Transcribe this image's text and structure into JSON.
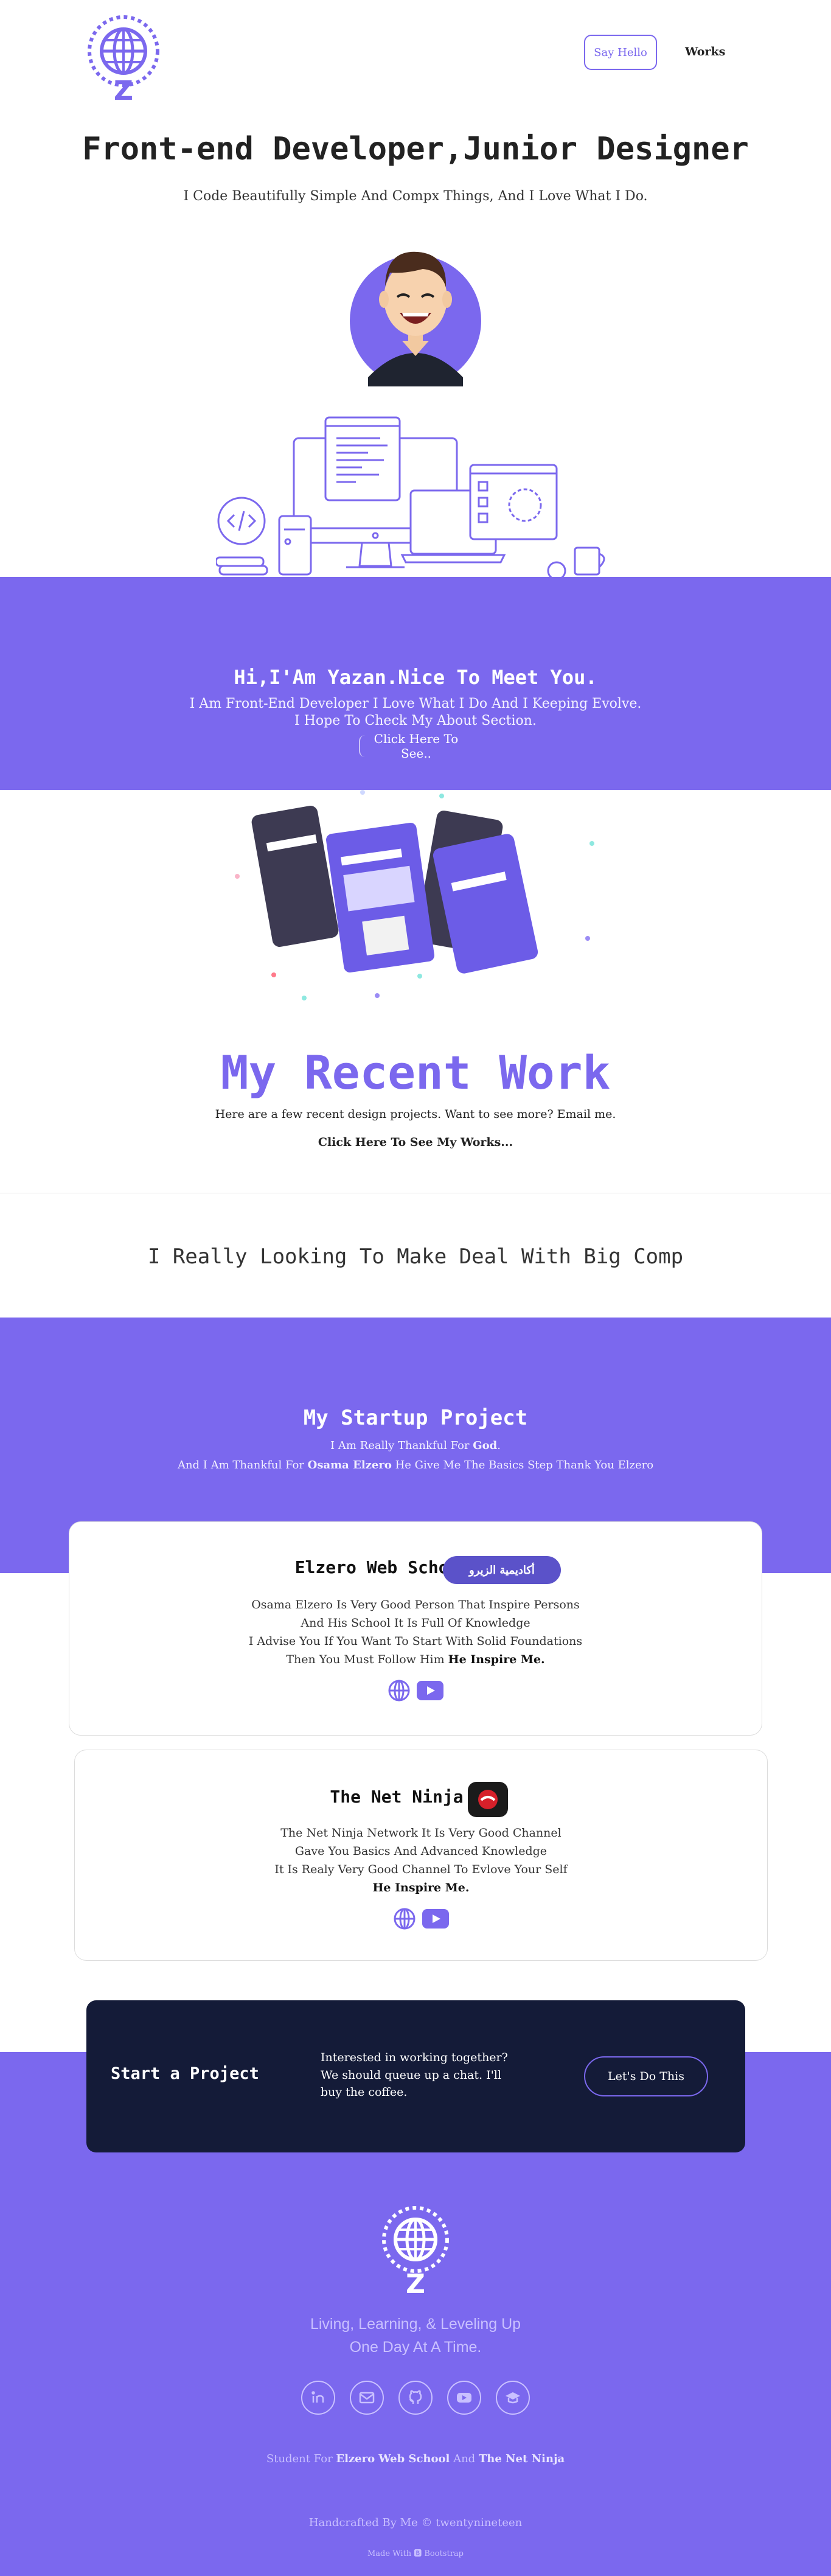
{
  "nav": {
    "say_hello": "Say Hello",
    "works": "Works",
    "logo_letter": "Z"
  },
  "hero": {
    "title": "Front-end Developer,Junior Designer",
    "subtitle": "I Code Beautifully Simple And Compx Things, And I Love What I Do."
  },
  "about": {
    "title": "Hi,I'Am Yazan.Nice To Meet You.",
    "line1": "I Am Front-End Developer I Love What I Do And I Keeping Evolve.",
    "line2": "I Hope To Check My About Section.",
    "link": "Click Here To See.."
  },
  "recent": {
    "title": "My Recent Work",
    "subtitle": "Here are a few recent design projects. Want to see more? Email me.",
    "link": "Click Here To See My Works..."
  },
  "deal": {
    "text": "I Really Looking To Make Deal With Big Comp"
  },
  "startup": {
    "title": "My Startup Project",
    "line1_prefix": "I Am Really Thankful For ",
    "line1_bold": "God",
    "line1_suffix": ".",
    "line2_prefix": "And I Am Thankful For ",
    "line2_bold": "Osama Elzero",
    "line2_suffix": " He Give Me The Basics Step Thank You Elzero"
  },
  "cards": [
    {
      "title": "Elzero Web School",
      "badge": "أكاديمية الزيرو",
      "lines": [
        "Osama Elzero Is Very Good Person That Inspire Persons",
        "And His School It Is Full Of Knowledge",
        "I Advise You If You Want To Start With Solid Foundations"
      ],
      "last_prefix": "Then You Must Follow Him ",
      "inspire": "He Inspire Me."
    },
    {
      "title": "The Net Ninja",
      "lines": [
        "The Net Ninja Network It Is Very Good Channel",
        "Gave You Basics And Advanced Knowledge",
        "It Is Realy Very Good Channel To Evlove Your Self"
      ],
      "inspire": "He Inspire Me."
    }
  ],
  "project": {
    "title": "Start a Project",
    "text": "Interested in working together? We should queue up a chat. I'll buy the coffee.",
    "button": "Let's Do This"
  },
  "footer": {
    "logo_letter": "Z",
    "tagline1": "Living, Learning, & Leveling Up",
    "tagline2": "One Day At A Time.",
    "student_prefix": "Student For ",
    "student_bold1": "Elzero Web School",
    "student_mid": " And ",
    "student_bold2": "The Net Ninja",
    "handcrafted": "Handcrafted By Me © twentynineteen",
    "made_with": "Made With 🅱 Bootstrap"
  },
  "colors": {
    "accent": "#7b68ee",
    "dark": "#141b38",
    "light_text": "#c9c0ff"
  },
  "icons": [
    "globe-logo-icon",
    "globe-icon",
    "youtube-icon",
    "linkedin-icon",
    "email-icon",
    "github-icon",
    "graduation-cap-icon"
  ]
}
